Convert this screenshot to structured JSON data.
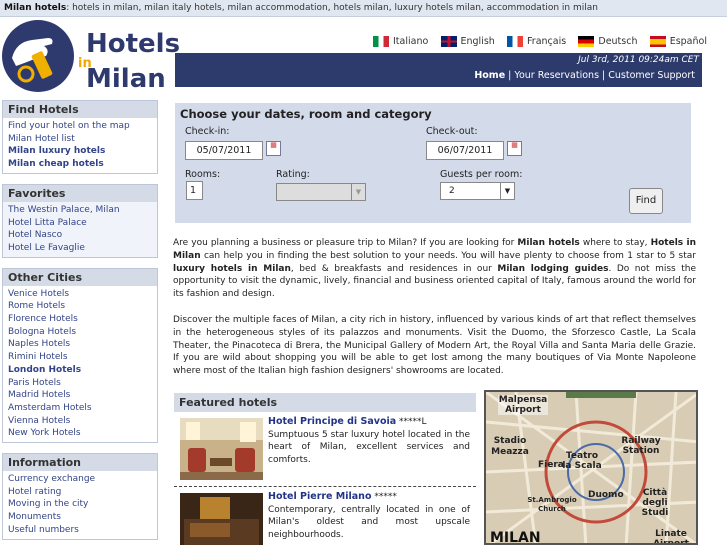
{
  "topstrip": {
    "bold": "Milan hotels",
    "text": ": hotels in milan, milan italy hotels, milan accommodation, hotels milan, luxury hotels milan, accommodation in milan"
  },
  "logo": {
    "line1": "Hotels",
    "line2": "in",
    "line3": "Milan"
  },
  "languages": [
    {
      "label": "Italiano",
      "flag": "it-flag"
    },
    {
      "label": "English",
      "flag": "uk-flag"
    },
    {
      "label": "Français",
      "flag": "fr-flag"
    },
    {
      "label": "Deutsch",
      "flag": "de-flag"
    },
    {
      "label": "Español",
      "flag": "es-flag"
    }
  ],
  "header": {
    "datetime": "Jul 3rd, 2011 09:24am CET",
    "nav": {
      "home": "Home",
      "sep": " | ",
      "reservations": "Your Reservations",
      "support": "Customer Support"
    }
  },
  "sidebar": {
    "find": {
      "title": "Find Hotels",
      "items": [
        "Find your hotel on the map",
        "Milan Hotel list",
        "Milan luxury hotels",
        "Milan cheap hotels"
      ]
    },
    "favorites": {
      "title": "Favorites",
      "items": [
        "The Westin Palace, Milan",
        "Hotel Litta Palace",
        "Hotel Nasco",
        "Hotel Le Favaglie"
      ]
    },
    "cities": {
      "title": "Other Cities",
      "items": [
        "Venice Hotels",
        "Rome Hotels",
        "Florence Hotels",
        "Bologna Hotels",
        "Naples Hotels",
        "Rimini Hotels",
        "London Hotels",
        "Paris Hotels",
        "Madrid Hotels",
        "Amsterdam Hotels",
        "Vienna Hotels",
        "New York Hotels"
      ]
    },
    "information": {
      "title": "Information",
      "items": [
        "Currency exchange",
        "Hotel rating",
        "Moving in the city",
        "Monuments",
        "Useful numbers"
      ]
    }
  },
  "search": {
    "title": "Choose your dates, room and category",
    "checkin_label": "Check-in:",
    "checkin_value": "05/07/2011",
    "checkout_label": "Check-out:",
    "checkout_value": "06/07/2011",
    "rooms_label": "Rooms:",
    "rooms_value": "1",
    "rating_label": "Rating:",
    "rating_value": "",
    "guests_label": "Guests per room:",
    "guests_value": "2",
    "find_button": "Find"
  },
  "intro": {
    "p1": [
      "Are you planning a business or pleasure trip to Milan? If you are looking for ",
      "Milan hotels",
      " where to stay, ",
      "Hotels in Milan",
      " can help you in finding the best solution to your needs. You will have plenty to choose from 1 star to 5 star ",
      "luxury hotels in Milan",
      ", bed & breakfasts and residences in our ",
      "Milan lodging guides",
      ". Do not miss the opportunity to visit the dynamic, lively, financial and business oriented capital of Italy, famous around the world for its fashion and design."
    ],
    "p2": "Discover the multiple faces of Milan, a city rich in history, influenced by various kinds of art that reflect themselves in the heterogeneous styles of its palazzos and monuments. Visit the Duomo, the Sforzesco Castle, La Scala Theater, the Pinacoteca di Brera, the Municipal Gallery of Modern Art, the Royal Villa and Santa Maria delle Grazie. If you are wild about shopping you will be able to get lost among the many boutiques of Via Monte Napoleone where most of the Italian high fashion designers' showrooms are located."
  },
  "featured": {
    "title": "Featured hotels",
    "hotels": [
      {
        "name": "Hotel Principe di Savoia",
        "stars": " *****L",
        "desc": "Sumptuous 5 star luxury hotel located in the heart of Milan, excellent services and comforts."
      },
      {
        "name": "Hotel Pierre Milano",
        "stars": " *****",
        "desc": "Contemporary, centrally located in one of Milan's oldest and most upscale neighbourhoods."
      }
    ]
  },
  "map": {
    "labels": [
      "Malpensa Airport",
      "Stadio Meazza",
      "Railway Station",
      "Teatro la Scala",
      "Fiera",
      "St.Ambrogio Church",
      "Duomo",
      "Città degli Studi",
      "MILAN",
      "Linate Airport"
    ]
  }
}
